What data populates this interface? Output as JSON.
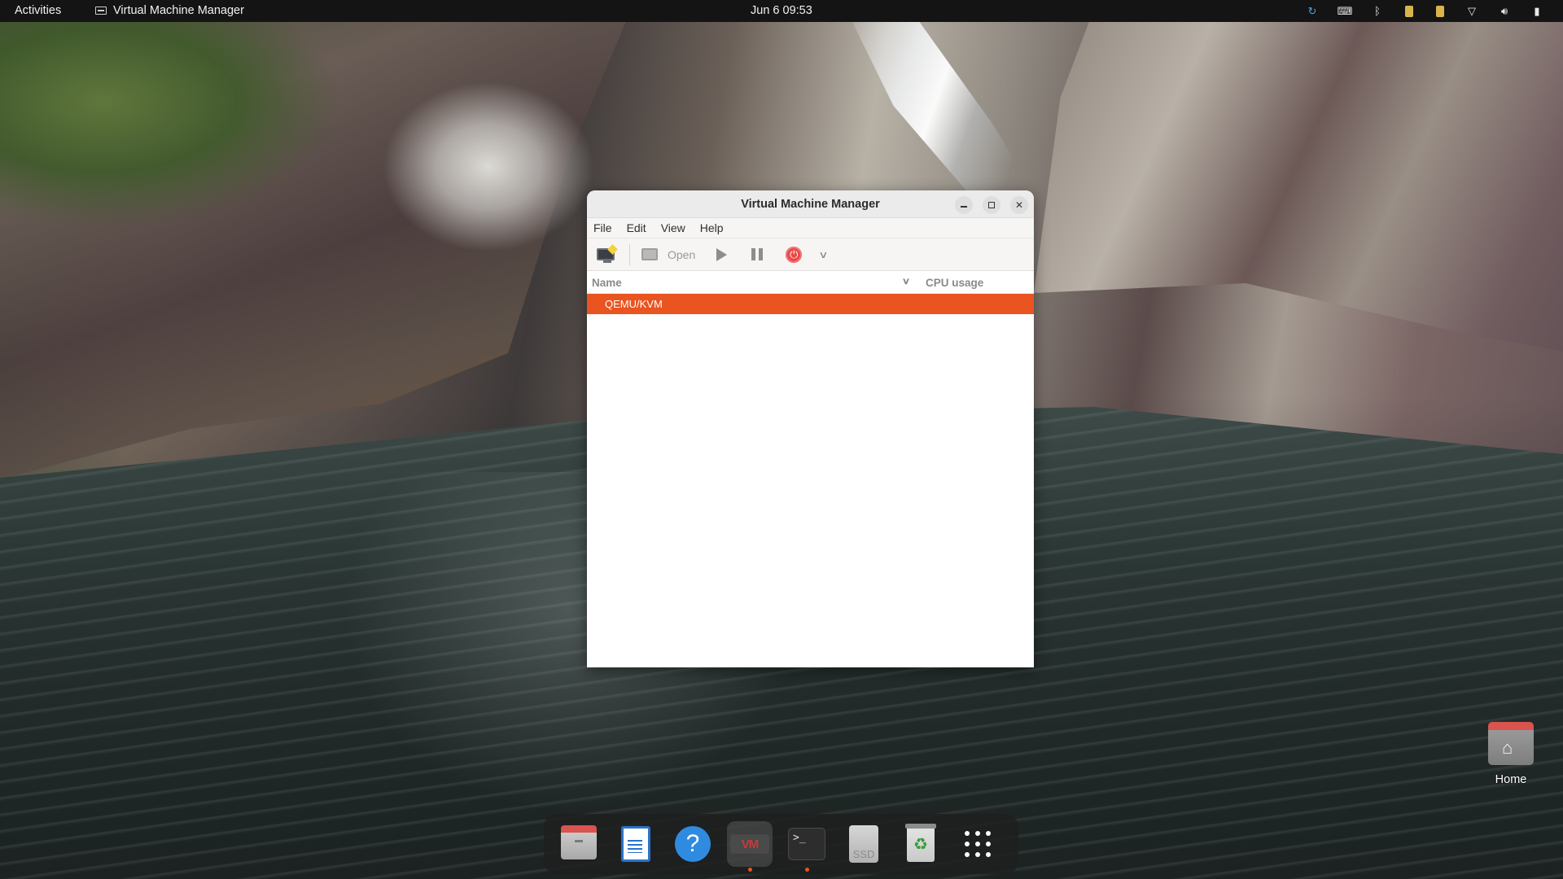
{
  "topbar": {
    "activities": "Activities",
    "app_name": "Virtual Machine Manager",
    "clock": "Jun 6  09:53",
    "tray_icons": [
      "sync-icon",
      "keyboard-icon",
      "bluetooth-icon",
      "clipboard-icon",
      "clipboard-icon",
      "wifi-icon",
      "volume-icon",
      "battery-icon"
    ]
  },
  "window": {
    "title": "Virtual Machine Manager",
    "menu": {
      "file": "File",
      "edit": "Edit",
      "view": "View",
      "help": "Help"
    },
    "toolbar": {
      "open_label": "Open"
    },
    "list": {
      "columns": {
        "name": "Name",
        "cpu": "CPU usage"
      },
      "rows": [
        "QEMU/KVM"
      ],
      "selected_color": "#e95420"
    }
  },
  "desktop": {
    "home_label": "Home"
  },
  "dock": {
    "items": [
      "files-icon",
      "libreoffice-writer-icon",
      "help-icon",
      "virt-manager-icon",
      "terminal-icon",
      "ssd-drive-icon",
      "trash-icon",
      "show-apps-icon"
    ],
    "vmm_label": "VM",
    "ssd_label": "SSD",
    "terminal_prompt": ">_"
  }
}
